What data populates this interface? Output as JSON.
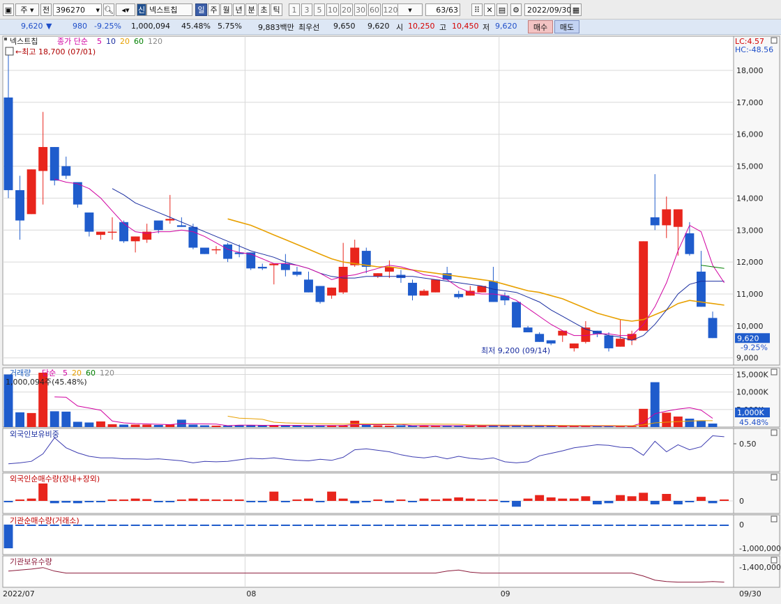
{
  "toolbar": {
    "period_select": "주",
    "prev_label": "전",
    "code": "396270",
    "name_badge": "신",
    "stock_name": "넥스트칩",
    "tabs": [
      "일",
      "주",
      "월",
      "년",
      "분",
      "초",
      "틱"
    ],
    "active_tab": "일",
    "intervals": [
      "1",
      "3",
      "5",
      "10",
      "20",
      "30",
      "60",
      "120"
    ],
    "count": "63",
    "count_total": "/63",
    "date": "2022/09/30"
  },
  "quote": {
    "price": "9,620",
    "arrow": "▼",
    "change": "980",
    "change_pct": "-9.25%",
    "volume": "1,000,094",
    "vol_ratio": "45.48%",
    "turnover": "5.75%",
    "amount": "9,883백만",
    "best_label": "최우선",
    "best_ask": "9,650",
    "best_bid": "9,620",
    "open_label": "시",
    "open": "10,250",
    "high_label": "고",
    "high": "10,450",
    "low_label": "저",
    "low": "9,620",
    "buy_label": "매수",
    "sell_label": "매도"
  },
  "panels": {
    "price": {
      "name": "넥스트칩",
      "ma_label": "종가 단순",
      "ma_periods": [
        "5",
        "10",
        "20",
        "60",
        "120"
      ],
      "high_note": "←최고 18,700 (07/01)",
      "low_note": "최저 9,200 (09/14)",
      "lc": "LC:4.57",
      "hc": "HC:-48.56",
      "last_price": "9,620",
      "last_pct": "-9.25%"
    },
    "volume": {
      "name": "거래량",
      "ma_label": "단순",
      "ma_periods": [
        "5",
        "20",
        "60",
        "120"
      ],
      "value_note": "1,000,094주(45.48%)",
      "last_value": "1,000K",
      "last_pct": "45.48%"
    },
    "foreign_ratio": {
      "name": "외국인보유비중"
    },
    "foreign_net": {
      "name": "외국인순매수량(장내+장외)"
    },
    "inst_net": {
      "name": "기관순매수량(거래소)"
    },
    "inst_hold": {
      "name": "기관보유수량"
    }
  },
  "x_axis": {
    "labels": [
      "2022/07",
      "08",
      "09",
      "09/30"
    ]
  },
  "colors": {
    "up": "#e8251c",
    "down": "#1f5ccc",
    "ma5": "#d000a0",
    "ma10": "#1a2ea0",
    "ma20": "#e8a000",
    "ma60": "#008000",
    "bg": "#ffffff",
    "grid": "#d8d8d8"
  },
  "chart_data": {
    "type": "candlestick",
    "price_ticks": [
      9000,
      10000,
      11000,
      12000,
      13000,
      14000,
      15000,
      16000,
      17000,
      18000
    ],
    "price_range": [
      8950,
      18850
    ],
    "candles": [
      {
        "o": 17150,
        "h": 18700,
        "l": 14000,
        "c": 14250
      },
      {
        "o": 14250,
        "h": 14700,
        "l": 12700,
        "c": 13300
      },
      {
        "o": 13500,
        "h": 14800,
        "l": 13600,
        "c": 14900
      },
      {
        "o": 14850,
        "h": 16700,
        "l": 13800,
        "c": 15600
      },
      {
        "o": 15600,
        "h": 15500,
        "l": 14400,
        "c": 14550
      },
      {
        "o": 15000,
        "h": 15300,
        "l": 14600,
        "c": 14700
      },
      {
        "o": 14500,
        "h": 14500,
        "l": 13700,
        "c": 13800
      },
      {
        "o": 13550,
        "h": 13400,
        "l": 12800,
        "c": 12950
      },
      {
        "o": 12850,
        "h": 12900,
        "l": 12700,
        "c": 12950
      },
      {
        "o": 12950,
        "h": 13400,
        "l": 12700,
        "c": 12950
      },
      {
        "o": 13250,
        "h": 13300,
        "l": 12600,
        "c": 12650
      },
      {
        "o": 12650,
        "h": 12800,
        "l": 12300,
        "c": 12800
      },
      {
        "o": 12700,
        "h": 13200,
        "l": 12600,
        "c": 12950
      },
      {
        "o": 13300,
        "h": 13300,
        "l": 12900,
        "c": 13000
      },
      {
        "o": 13300,
        "h": 14100,
        "l": 13200,
        "c": 13350
      },
      {
        "o": 13150,
        "h": 13400,
        "l": 13100,
        "c": 13100
      },
      {
        "o": 13100,
        "h": 13200,
        "l": 12400,
        "c": 12450
      },
      {
        "o": 12450,
        "h": 12400,
        "l": 12250,
        "c": 12250
      },
      {
        "o": 12400,
        "h": 12500,
        "l": 12250,
        "c": 12400
      },
      {
        "o": 12550,
        "h": 12600,
        "l": 12000,
        "c": 12100
      },
      {
        "o": 12300,
        "h": 12550,
        "l": 12150,
        "c": 12250
      },
      {
        "o": 12300,
        "h": 12200,
        "l": 11750,
        "c": 11800
      },
      {
        "o": 11850,
        "h": 11950,
        "l": 11750,
        "c": 11800
      },
      {
        "o": 11900,
        "h": 11950,
        "l": 11300,
        "c": 11950
      },
      {
        "o": 11950,
        "h": 12250,
        "l": 11550,
        "c": 11750
      },
      {
        "o": 11700,
        "h": 11850,
        "l": 11550,
        "c": 11600
      },
      {
        "o": 11450,
        "h": 11700,
        "l": 11050,
        "c": 11050
      },
      {
        "o": 11250,
        "h": 11250,
        "l": 10700,
        "c": 10750
      },
      {
        "o": 10950,
        "h": 11200,
        "l": 10850,
        "c": 11200
      },
      {
        "o": 11050,
        "h": 12600,
        "l": 11000,
        "c": 11850
      },
      {
        "o": 11900,
        "h": 12700,
        "l": 11850,
        "c": 12450
      },
      {
        "o": 12350,
        "h": 12450,
        "l": 11650,
        "c": 11850
      },
      {
        "o": 11550,
        "h": 11650,
        "l": 11500,
        "c": 11650
      },
      {
        "o": 11700,
        "h": 12050,
        "l": 11500,
        "c": 11850
      },
      {
        "o": 11600,
        "h": 11750,
        "l": 11350,
        "c": 11500
      },
      {
        "o": 11350,
        "h": 11450,
        "l": 10800,
        "c": 10950
      },
      {
        "o": 10950,
        "h": 11150,
        "l": 10950,
        "c": 11100
      },
      {
        "o": 11050,
        "h": 11300,
        "l": 11050,
        "c": 11450
      },
      {
        "o": 11650,
        "h": 11850,
        "l": 11450,
        "c": 11450
      },
      {
        "o": 11000,
        "h": 11100,
        "l": 10850,
        "c": 10900
      },
      {
        "o": 10950,
        "h": 11250,
        "l": 11000,
        "c": 11100
      },
      {
        "o": 11050,
        "h": 11250,
        "l": 11150,
        "c": 11250
      },
      {
        "o": 11400,
        "h": 11850,
        "l": 10750,
        "c": 10750
      },
      {
        "o": 10950,
        "h": 11050,
        "l": 10650,
        "c": 10800
      },
      {
        "o": 10750,
        "h": 10750,
        "l": 9950,
        "c": 9950
      },
      {
        "o": 9950,
        "h": 10000,
        "l": 9800,
        "c": 9800
      },
      {
        "o": 9750,
        "h": 9800,
        "l": 9500,
        "c": 9500
      },
      {
        "o": 9550,
        "h": 9550,
        "l": 9400,
        "c": 9450
      },
      {
        "o": 9700,
        "h": 9750,
        "l": 9500,
        "c": 9850
      },
      {
        "o": 9300,
        "h": 9450,
        "l": 9200,
        "c": 9450
      },
      {
        "o": 9500,
        "h": 10150,
        "l": 9450,
        "c": 9950
      },
      {
        "o": 9850,
        "h": 9850,
        "l": 9650,
        "c": 9750
      },
      {
        "o": 9700,
        "h": 9800,
        "l": 9200,
        "c": 9300
      },
      {
        "o": 9350,
        "h": 10200,
        "l": 9400,
        "c": 9600
      },
      {
        "o": 9550,
        "h": 9850,
        "l": 9400,
        "c": 9750
      },
      {
        "o": 9850,
        "h": 11100,
        "l": 9850,
        "c": 12650
      },
      {
        "o": 13400,
        "h": 14750,
        "l": 13000,
        "c": 13150
      },
      {
        "o": 13150,
        "h": 14050,
        "l": 12750,
        "c": 13650
      },
      {
        "o": 13100,
        "h": 13600,
        "l": 12200,
        "c": 13650
      },
      {
        "o": 12900,
        "h": 13250,
        "l": 12200,
        "c": 12250
      },
      {
        "o": 11700,
        "h": 12350,
        "l": 10650,
        "c": 10600
      },
      {
        "o": 10250,
        "h": 10450,
        "l": 9620,
        "c": 9620
      }
    ],
    "ma5": [
      null,
      null,
      null,
      null,
      14600,
      14500,
      14450,
      14300,
      14000,
      13600,
      13200,
      12950,
      12900,
      12950,
      12950,
      13000,
      12950,
      12800,
      12600,
      12400,
      12300,
      12250,
      12100,
      11950,
      11950,
      11900,
      11800,
      11650,
      11450,
      11550,
      11600,
      11700,
      11800,
      11900,
      11850,
      11750,
      11600,
      11550,
      11450,
      11200,
      11050,
      11000,
      11000,
      10950,
      10800,
      10550,
      10300,
      10050,
      9850,
      9700,
      9700,
      9750,
      9750,
      9700,
      9700,
      10050,
      10600,
      11350,
      12350,
      13150,
      12950,
      11900,
      11350
    ],
    "ma10": [
      null,
      null,
      null,
      null,
      null,
      null,
      null,
      null,
      null,
      14300,
      14100,
      13850,
      13700,
      13550,
      13400,
      13250,
      13100,
      12950,
      12800,
      12650,
      12500,
      12350,
      12250,
      12150,
      12000,
      11900,
      11800,
      11650,
      11550,
      11500,
      11500,
      11550,
      11550,
      11550,
      11550,
      11550,
      11500,
      11450,
      11400,
      11350,
      11300,
      11250,
      11150,
      11100,
      11050,
      10900,
      10750,
      10500,
      10300,
      10100,
      9900,
      9800,
      9700,
      9650,
      9550,
      9700,
      10050,
      10500,
      11000,
      11300,
      11400,
      11400,
      11400
    ],
    "ma20": [
      null,
      null,
      null,
      null,
      null,
      null,
      null,
      null,
      null,
      null,
      null,
      null,
      null,
      null,
      null,
      null,
      null,
      null,
      null,
      13350,
      13250,
      13150,
      13000,
      12850,
      12700,
      12550,
      12400,
      12250,
      12100,
      12000,
      11950,
      11900,
      11850,
      11850,
      11800,
      11750,
      11700,
      11650,
      11600,
      11550,
      11500,
      11450,
      11400,
      11300,
      11200,
      11100,
      11050,
      10950,
      10850,
      10700,
      10550,
      10400,
      10300,
      10200,
      10150,
      10200,
      10350,
      10500,
      10700,
      10800,
      10750,
      10700,
      10650
    ],
    "ma60": [
      null,
      null,
      null,
      null,
      null,
      null,
      null,
      null,
      null,
      null,
      null,
      null,
      null,
      null,
      null,
      null,
      null,
      null,
      null,
      null,
      null,
      null,
      null,
      null,
      null,
      null,
      null,
      null,
      null,
      null,
      null,
      null,
      null,
      null,
      null,
      null,
      null,
      null,
      null,
      null,
      null,
      null,
      null,
      null,
      null,
      null,
      null,
      null,
      null,
      null,
      null,
      null,
      null,
      null,
      null,
      null,
      null,
      null,
      null,
      null,
      11900,
      11850,
      11800
    ],
    "volume_ticks": [
      {
        "v": 5000,
        "label": "5,000K"
      },
      {
        "v": 10000,
        "label": "10,000K"
      },
      {
        "v": 15000,
        "label": "15,000K"
      }
    ],
    "volume_max": 16500,
    "volume": [
      15000,
      4200,
      4000,
      15500,
      4500,
      4400,
      1500,
      1300,
      1600,
      800,
      700,
      700,
      700,
      600,
      700,
      2100,
      700,
      500,
      400,
      400,
      600,
      600,
      500,
      400,
      500,
      500,
      400,
      400,
      400,
      400,
      1800,
      600,
      500,
      400,
      500,
      400,
      400,
      400,
      400,
      400,
      400,
      400,
      400,
      400,
      400,
      400,
      300,
      300,
      300,
      300,
      300,
      300,
      300,
      300,
      300,
      5200,
      12800,
      4100,
      3000,
      2400,
      1900,
      1000
    ],
    "vol_ma5": [
      null,
      null,
      null,
      null,
      8600,
      8500,
      6000,
      5400,
      4800,
      1700,
      1200,
      1000,
      900,
      800,
      700,
      1000,
      950,
      900,
      850,
      400,
      550,
      550,
      500,
      500,
      500,
      500,
      450,
      450,
      450,
      450,
      700,
      720,
      700,
      700,
      770,
      400,
      450,
      400,
      400,
      400,
      400,
      400,
      400,
      400,
      400,
      400,
      380,
      350,
      330,
      310,
      300,
      300,
      300,
      300,
      300,
      1280,
      3800,
      4560,
      5120,
      5500,
      4840,
      2480
    ],
    "vol_ma20": [
      null,
      null,
      null,
      null,
      null,
      null,
      null,
      null,
      null,
      null,
      null,
      null,
      null,
      null,
      null,
      null,
      null,
      null,
      null,
      3100,
      2550,
      2400,
      2200,
      1400,
      1200,
      1100,
      1000,
      950,
      900,
      850,
      920,
      900,
      880,
      870,
      860,
      860,
      850,
      840,
      820,
      800,
      620,
      580,
      570,
      560,
      550,
      520,
      510,
      500,
      480,
      460,
      440,
      420,
      410,
      400,
      400,
      600,
      1200,
      1400,
      1550,
      1700,
      1800,
      1800
    ],
    "foreign_ratio": [
      0.1,
      0.12,
      0.15,
      0.3,
      0.62,
      0.42,
      0.32,
      0.25,
      0.22,
      0.22,
      0.2,
      0.2,
      0.19,
      0.2,
      0.18,
      0.16,
      0.12,
      0.15,
      0.14,
      0.15,
      0.18,
      0.21,
      0.2,
      0.22,
      0.19,
      0.17,
      0.16,
      0.19,
      0.17,
      0.23,
      0.38,
      0.4,
      0.37,
      0.34,
      0.28,
      0.24,
      0.22,
      0.25,
      0.2,
      0.25,
      0.21,
      0.19,
      0.22,
      0.14,
      0.12,
      0.14,
      0.26,
      0.31,
      0.36,
      0.42,
      0.45,
      0.48,
      0.47,
      0.43,
      0.42,
      0.27,
      0.55,
      0.34,
      0.48,
      0.38,
      0.44,
      0.66,
      0.64
    ],
    "foreign_net": [
      -10,
      0,
      20,
      150,
      -20,
      -15,
      -20,
      -10,
      -5,
      0,
      10,
      20,
      15,
      -10,
      -5,
      10,
      20,
      15,
      10,
      5,
      10,
      -10,
      -5,
      80,
      -5,
      10,
      20,
      -10,
      80,
      20,
      -20,
      -10,
      10,
      -15,
      10,
      -5,
      20,
      0,
      20,
      30,
      20,
      0,
      0,
      -5,
      -50,
      20,
      50,
      30,
      20,
      20,
      40,
      -30,
      -20,
      50,
      40,
      70,
      -30,
      60,
      -30,
      -5,
      35,
      -20,
      0
    ],
    "inst_net": [
      -1000000,
      -30000,
      -20000,
      -20000,
      -10000,
      -10000,
      -10000,
      -10000,
      -10000,
      -10000,
      -10000,
      -10000,
      -10000,
      -10000,
      -10000,
      -10000,
      -10000,
      -10000,
      -10000,
      -10000,
      -10000,
      -10000,
      -10000,
      -10000,
      -10000,
      -10000,
      -10000,
      -10000,
      -10000,
      -10000,
      -10000,
      -10000,
      -10000,
      -10000,
      -10000,
      -10000,
      -10000,
      -10000,
      -10000,
      -10000,
      -10000,
      -10000,
      -10000,
      -10000,
      -10000,
      -10000,
      -10000,
      -10000,
      -10000,
      -10000,
      -10000,
      -10000,
      -10000,
      -10000,
      -10000,
      -10000,
      -10000,
      -10000,
      -10000,
      -10000,
      -10000,
      -10000,
      -10000
    ],
    "inst_hold": [
      -1290000,
      -1280000,
      -1270000,
      -1255000,
      -1290000,
      -1310000,
      -1310000,
      -1310000,
      -1310000,
      -1310000,
      -1310000,
      -1310000,
      -1310000,
      -1310000,
      -1310000,
      -1310000,
      -1310000,
      -1310000,
      -1310000,
      -1310000,
      -1310000,
      -1310000,
      -1310000,
      -1310000,
      -1310000,
      -1310000,
      -1310000,
      -1310000,
      -1310000,
      -1310000,
      -1310000,
      -1310000,
      -1310000,
      -1310000,
      -1310000,
      -1310000,
      -1310000,
      -1310000,
      -1290000,
      -1280000,
      -1300000,
      -1310000,
      -1310000,
      -1310000,
      -1310000,
      -1310000,
      -1310000,
      -1310000,
      -1310000,
      -1310000,
      -1310000,
      -1310000,
      -1310000,
      -1310000,
      -1310000,
      -1340000,
      -1380000,
      -1395000,
      -1400000,
      -1400000,
      -1400000,
      -1395000,
      -1400000
    ],
    "inst_hold_tick": {
      "v": -1400000,
      "label": "-1,400,000"
    },
    "foreign_ratio_tick": {
      "v": 0.5,
      "label": "0.50"
    },
    "foreign_net_tick": {
      "v": 0,
      "label": "0"
    },
    "inst_net_ticks": [
      {
        "v": 0,
        "label": "0"
      },
      {
        "v": -1000000,
        "label": "-1,000,000"
      }
    ]
  }
}
